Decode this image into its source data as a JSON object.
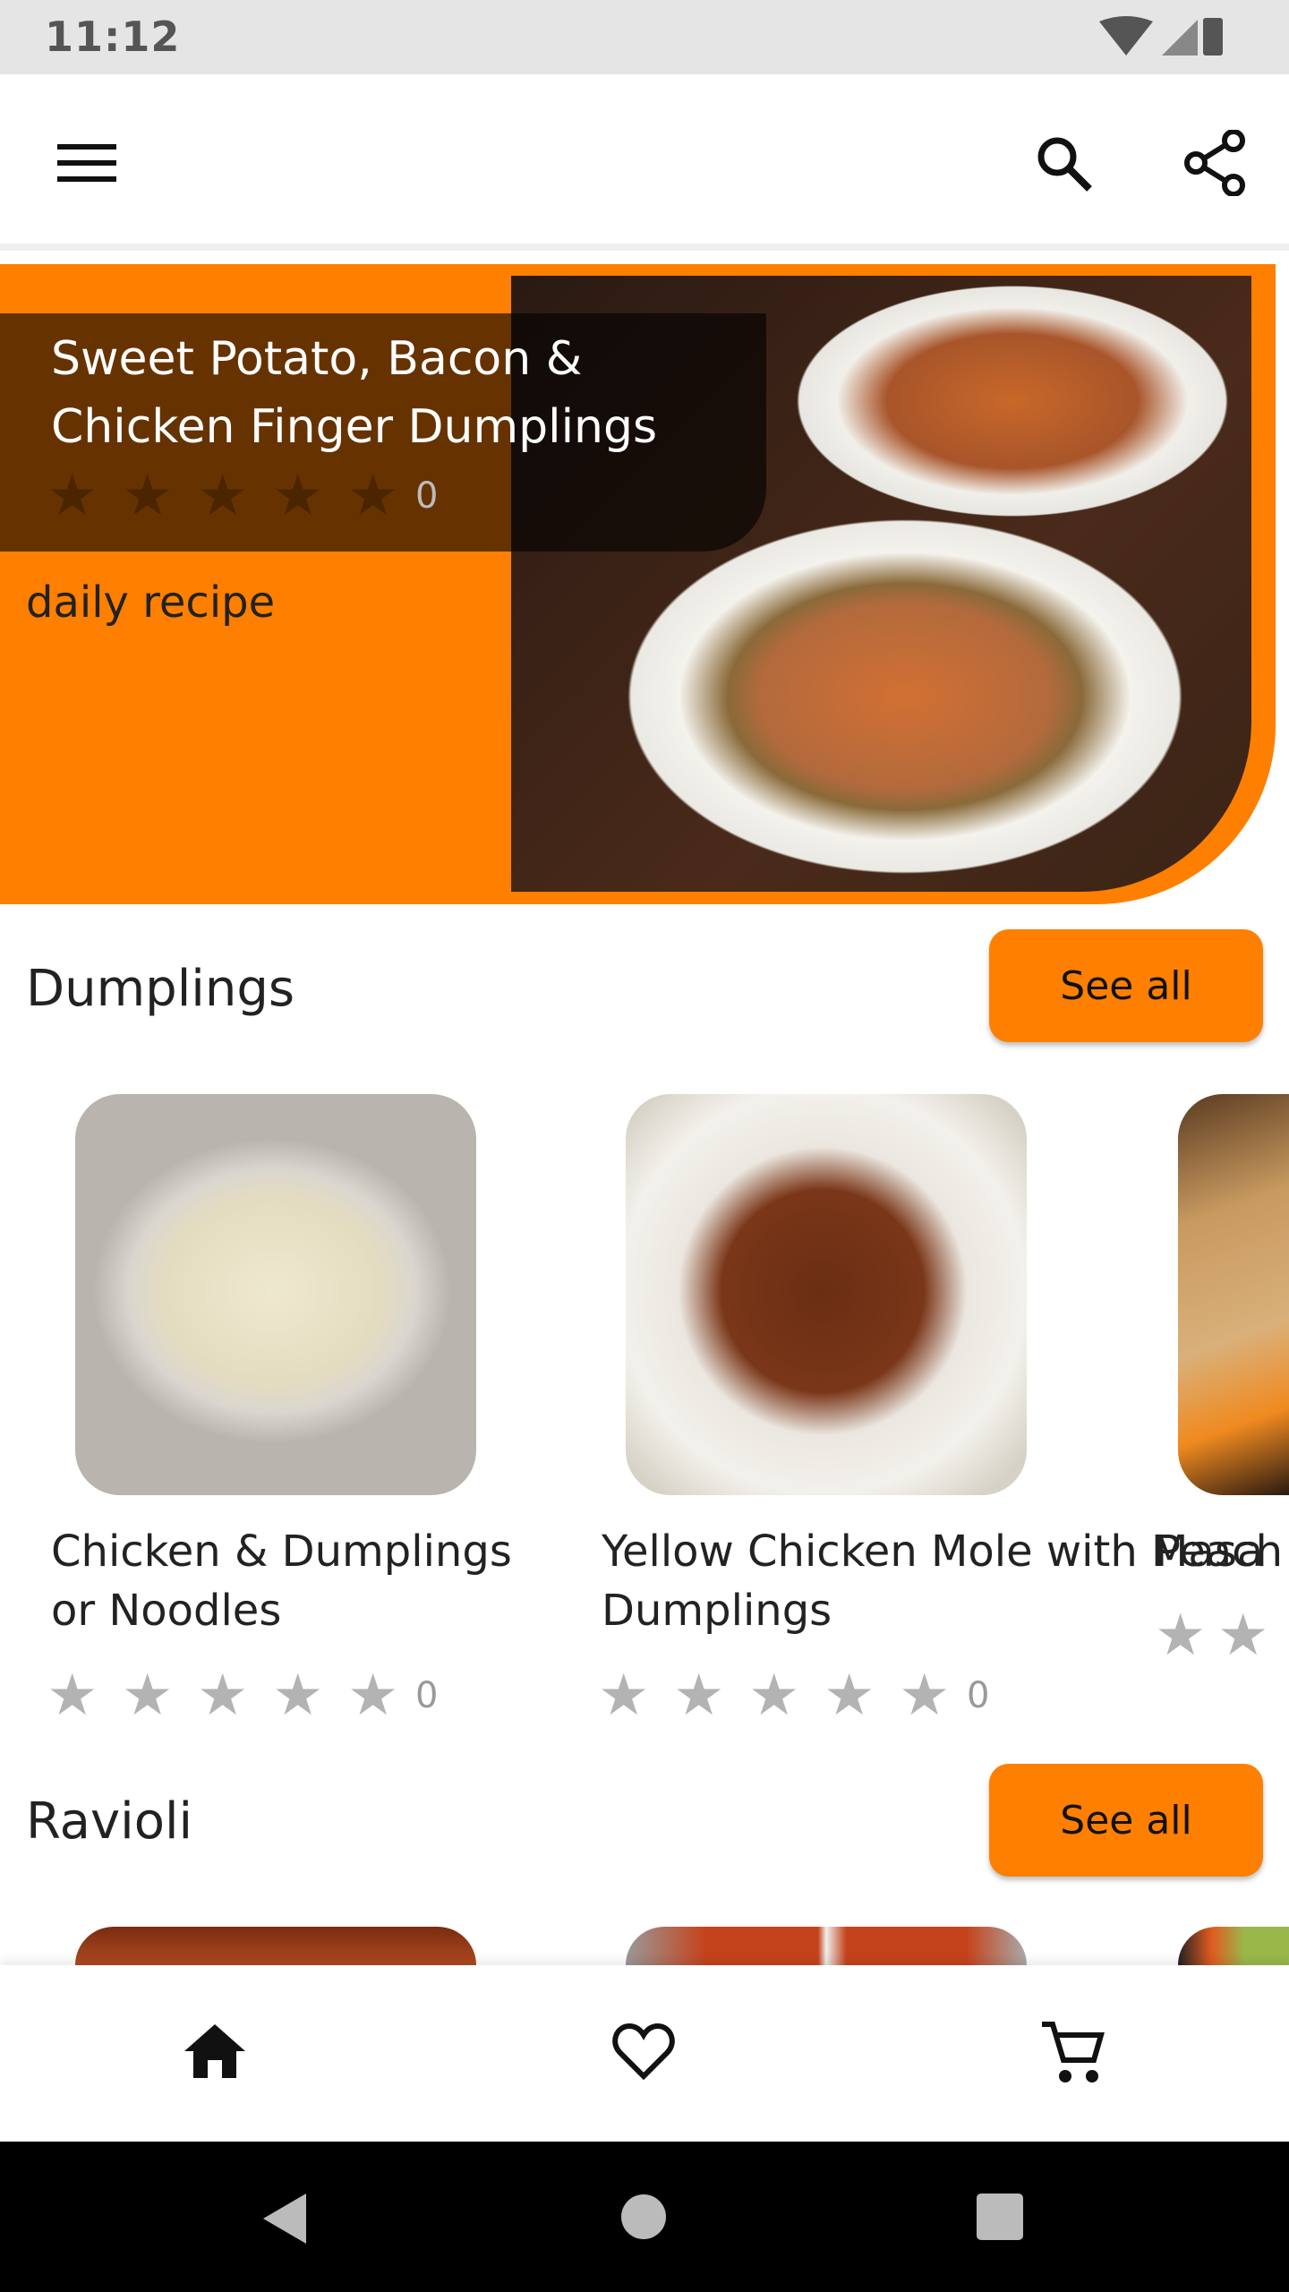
{
  "status_bar": {
    "time": "11:12"
  },
  "app_bar": {
    "menu_icon": "hamburger-menu-icon",
    "search_icon": "search-icon",
    "share_icon": "share-icon"
  },
  "hero": {
    "title": "Sweet Potato, Bacon & Chicken Finger Dumplings",
    "rating": 0,
    "rating_count": "0",
    "label": "daily recipe",
    "accent_color": "#ff7f00"
  },
  "sections": [
    {
      "title": "Dumplings",
      "see_all": "See all",
      "items": [
        {
          "title": "Chicken & Dumplings or Noodles",
          "rating": 0,
          "rating_count": "0"
        },
        {
          "title": "Yellow Chicken Mole with Masa Dumplings",
          "rating": 0,
          "rating_count": "0"
        },
        {
          "title": "Peach",
          "rating": 0
        }
      ]
    },
    {
      "title": "Ravioli",
      "see_all": "See all"
    }
  ],
  "star_glyph": "★",
  "bottom_nav": [
    "home-icon",
    "heart-icon",
    "cart-icon"
  ],
  "system_nav": [
    "back",
    "home",
    "recents"
  ]
}
